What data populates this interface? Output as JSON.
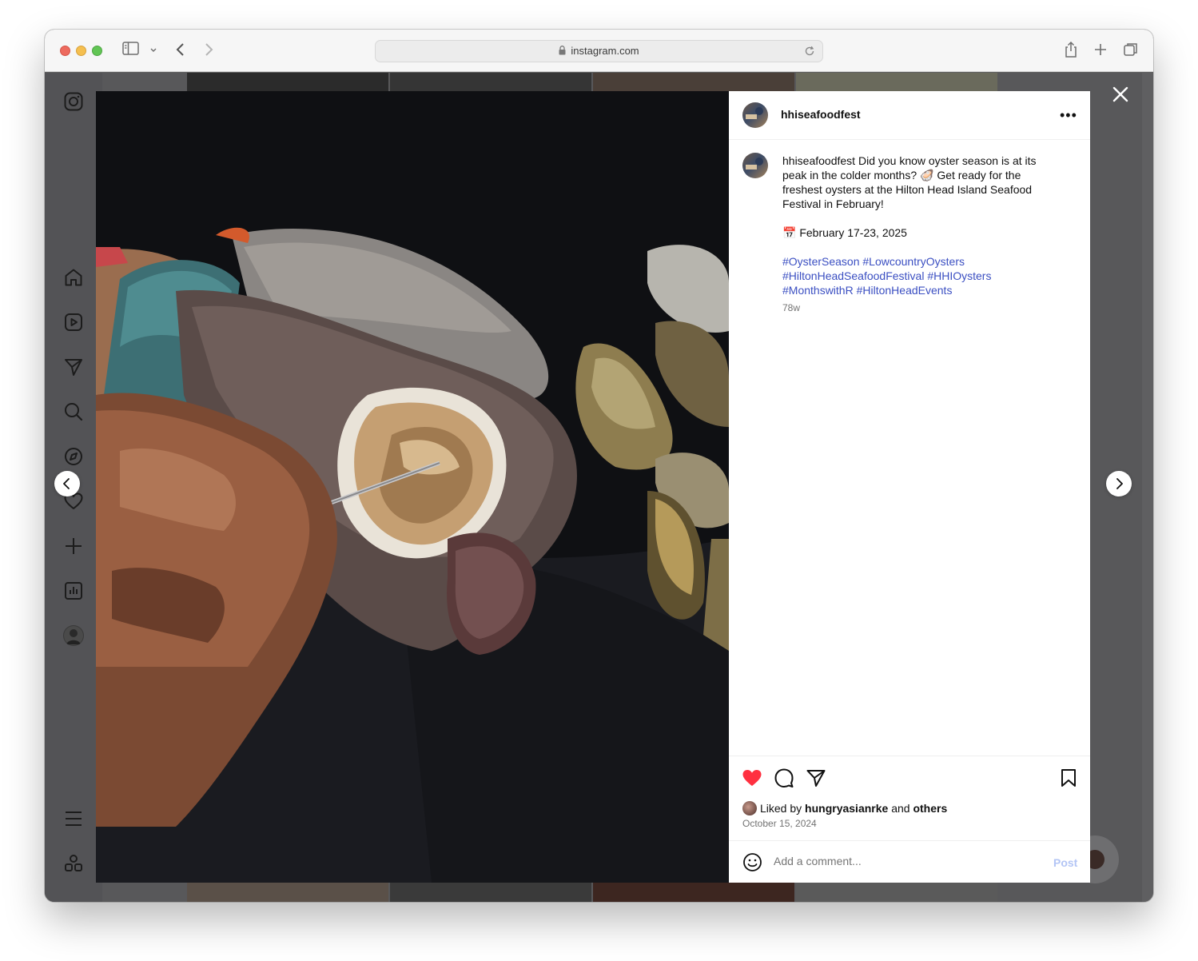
{
  "browser": {
    "url": "instagram.com"
  },
  "post": {
    "username": "hhiseafoodfest",
    "caption_user": "hhiseafoodfest",
    "caption_text": "Did you know oyster season is at its peak in the colder months? 🦪 Get ready for the freshest oysters at the Hilton Head Island Seafood Festival in February!",
    "date_line": "📅 February 17-23, 2025",
    "hashtags": [
      "#OysterSeason",
      "#LowcountryOysters",
      "#HiltonHeadSeafoodFestival",
      "#HHIOysters",
      "#MonthswithR",
      "#HiltonHeadEvents"
    ],
    "age": "78w",
    "liked_prefix": "Liked by",
    "liked_user": "hungryasianrke",
    "liked_and": "and",
    "liked_others": "others",
    "posted_date": "October 15, 2024",
    "comment_placeholder": "Add a comment...",
    "post_label": "Post"
  },
  "colors": {
    "like_red": "#ff3040",
    "hashtag_blue": "#3b4fc2",
    "post_disabled": "#b3c5f5"
  },
  "icons": {
    "sidebar": [
      "instagram-logo-icon",
      "home-icon",
      "reels-icon",
      "messages-icon",
      "search-icon",
      "explore-icon",
      "heart-icon",
      "create-icon",
      "insights-icon",
      "profile-avatar",
      "menu-icon",
      "apps-icon"
    ],
    "actions": [
      "heart-filled-icon",
      "comment-icon",
      "share-icon",
      "bookmark-icon"
    ]
  }
}
